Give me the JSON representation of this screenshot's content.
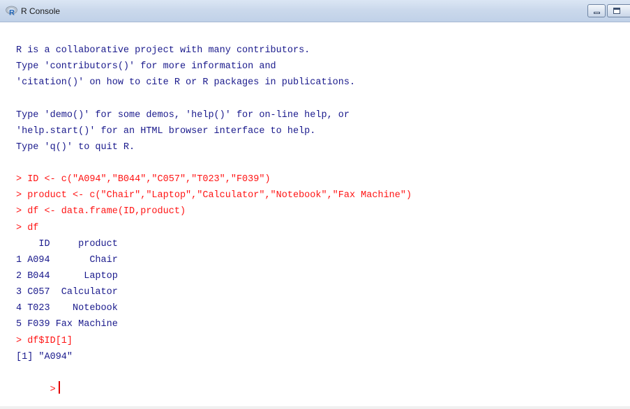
{
  "window": {
    "title": "R Console",
    "icon": "r-logo-icon"
  },
  "colors": {
    "output_text": "#1a1a8c",
    "input_text": "#ff1414",
    "cursor": "#e00000"
  },
  "console": {
    "lines": [
      {
        "type": "out",
        "text": "R is a collaborative project with many contributors."
      },
      {
        "type": "out",
        "text": "Type 'contributors()' for more information and"
      },
      {
        "type": "out",
        "text": "'citation()' on how to cite R or R packages in publications."
      },
      {
        "type": "blank",
        "text": ""
      },
      {
        "type": "out",
        "text": "Type 'demo()' for some demos, 'help()' for on-line help, or"
      },
      {
        "type": "out",
        "text": "'help.start()' for an HTML browser interface to help."
      },
      {
        "type": "out",
        "text": "Type 'q()' to quit R."
      },
      {
        "type": "blank",
        "text": ""
      },
      {
        "type": "cmd",
        "text": "> ID <- c(\"A094\",\"B044\",\"C057\",\"T023\",\"F039\")"
      },
      {
        "type": "cmd",
        "text": "> product <- c(\"Chair\",\"Laptop\",\"Calculator\",\"Notebook\",\"Fax Machine\")"
      },
      {
        "type": "cmd",
        "text": "> df <- data.frame(ID,product)"
      },
      {
        "type": "cmd",
        "text": "> df"
      },
      {
        "type": "out",
        "text": "    ID     product"
      },
      {
        "type": "out",
        "text": "1 A094       Chair"
      },
      {
        "type": "out",
        "text": "2 B044      Laptop"
      },
      {
        "type": "out",
        "text": "3 C057  Calculator"
      },
      {
        "type": "out",
        "text": "4 T023    Notebook"
      },
      {
        "type": "out",
        "text": "5 F039 Fax Machine"
      },
      {
        "type": "cmd",
        "text": "> df$ID[1]"
      },
      {
        "type": "out",
        "text": "[1] \"A094\""
      }
    ],
    "prompt": ">"
  }
}
